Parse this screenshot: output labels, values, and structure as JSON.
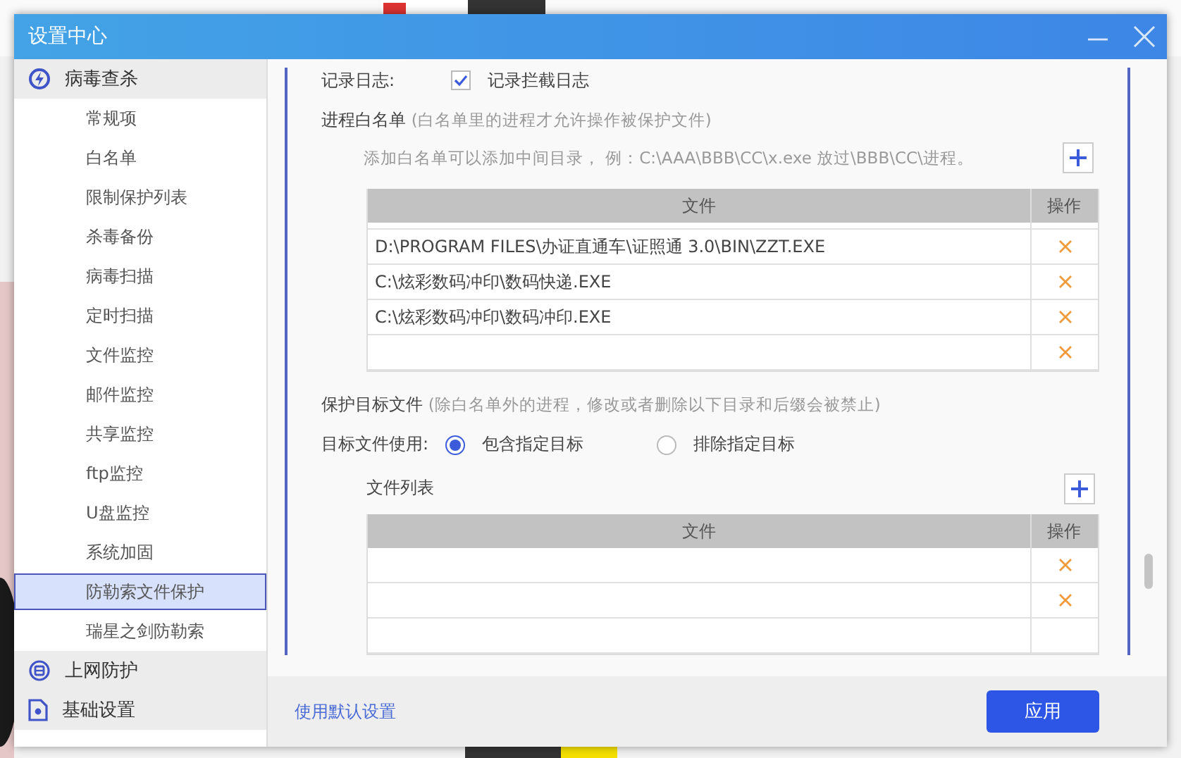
{
  "window": {
    "title": "设置中心"
  },
  "sidebar": {
    "groups": [
      {
        "label": "病毒查杀",
        "expanded": true,
        "children": [
          {
            "label": "常规项",
            "selected": false
          },
          {
            "label": "白名单",
            "selected": false
          },
          {
            "label": "限制保护列表",
            "selected": false
          },
          {
            "label": "杀毒备份",
            "selected": false
          },
          {
            "label": "病毒扫描",
            "selected": false
          },
          {
            "label": "定时扫描",
            "selected": false
          },
          {
            "label": "文件监控",
            "selected": false
          },
          {
            "label": "邮件监控",
            "selected": false
          },
          {
            "label": "共享监控",
            "selected": false
          },
          {
            "label": "ftp监控",
            "selected": false
          },
          {
            "label": "U盘监控",
            "selected": false
          },
          {
            "label": "系统加固",
            "selected": false
          },
          {
            "label": "防勒索文件保护",
            "selected": true
          },
          {
            "label": "瑞星之剑防勒索",
            "selected": false
          }
        ]
      },
      {
        "label": "上网防护",
        "expanded": false
      },
      {
        "label": "基础设置",
        "expanded": false
      }
    ]
  },
  "log": {
    "label": "记录日志:",
    "option": "记录拦截日志",
    "checked": true
  },
  "whitelist": {
    "title": "进程白名单",
    "note": "(白名单里的进程才允许操作被保护文件)",
    "hint": "添加白名单可以添加中间目录， 例：C:\\AAA\\BBB\\CC\\x.exe 放过\\BBB\\CC\\进程。",
    "columns": [
      "文件",
      "操作"
    ],
    "rows": [
      {
        "file": "D:\\PROGRAM FILES\\办证直通车\\证照通 3.0\\BIN\\ZZT.EXE",
        "deletable": true
      },
      {
        "file": "C:\\炫彩数码冲印\\数码快递.EXE",
        "deletable": true
      },
      {
        "file": "C:\\炫彩数码冲印\\数码冲印.EXE",
        "deletable": true
      },
      {
        "deletable": true
      }
    ]
  },
  "protect": {
    "title": "保护目标文件",
    "note": "(除白名单外的进程，修改或者删除以下目录和后缀会被禁止)",
    "mode_label": "目标文件使用:",
    "modes": [
      {
        "label": "包含指定目标",
        "selected": true
      },
      {
        "label": "排除指定目标",
        "selected": false
      }
    ],
    "list_title": "文件列表",
    "columns": [
      "文件",
      "操作"
    ],
    "rows": [
      {
        "deletable": true
      },
      {
        "deletable": true
      },
      {
        "deletable": false
      }
    ]
  },
  "footer": {
    "reset": "使用默认设置",
    "apply": "应用"
  }
}
